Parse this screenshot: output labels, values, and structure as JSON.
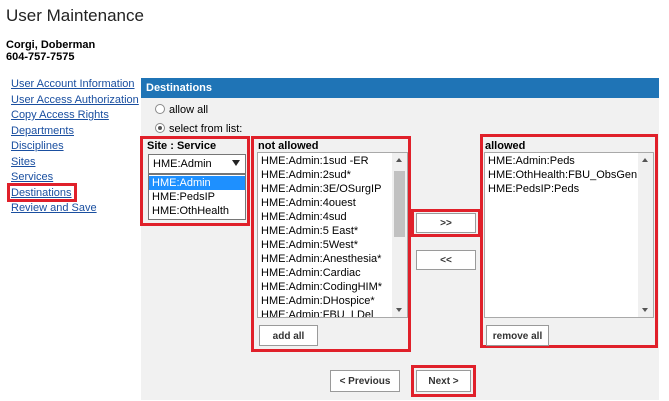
{
  "page": {
    "title": "User Maintenance",
    "user_name": "Corgi, Doberman",
    "user_phone": "604-757-7575"
  },
  "nav": {
    "items": [
      {
        "label": "User Account Information"
      },
      {
        "label": "User Access Authorization"
      },
      {
        "label": "Copy Access Rights"
      },
      {
        "label": "Departments"
      },
      {
        "label": "Disciplines"
      },
      {
        "label": "Sites"
      },
      {
        "label": "Services"
      },
      {
        "label": "Destinations",
        "active": true
      },
      {
        "label": "Review and Save"
      }
    ]
  },
  "destinations": {
    "header": "Destinations",
    "radio_allow_all": "allow all",
    "radio_select_from_list": "select from list:",
    "selected_option": "select from list:",
    "site_service_label": "Site : Service",
    "site_select": {
      "value": "HME:Admin",
      "options": [
        "HME:Admin",
        "HME:PedsIP",
        "HME:OthHealth"
      ]
    },
    "not_allowed": {
      "label": "not allowed",
      "items": [
        "HME:Admin:1sud -ER",
        "HME:Admin:2sud*",
        "HME:Admin:3E/OSurgIP",
        "HME:Admin:4ouest",
        "HME:Admin:4sud",
        "HME:Admin:5 East*",
        "HME:Admin:5West*",
        "HME:Admin:Anesthesia*",
        "HME:Admin:Cardiac",
        "HME:Admin:CodingHIM*",
        "HME:Admin:DHospice*",
        "HME:Admin:FBU_LDel"
      ],
      "add_all_label": "add all"
    },
    "move_right_label": ">>",
    "move_left_label": "<<",
    "allowed": {
      "label": "allowed",
      "items": [
        "HME:Admin:Peds",
        "HME:OthHealth:FBU_ObsGen",
        "HME:PedsIP:Peds"
      ],
      "remove_all_label": "remove all"
    },
    "previous_label": "< Previous",
    "next_label": "Next >"
  },
  "colors": {
    "header_blue": "#1f74b6",
    "highlight_red": "#e0202a",
    "link_blue": "#1a4fa0",
    "selection_blue": "#1e90ff"
  }
}
